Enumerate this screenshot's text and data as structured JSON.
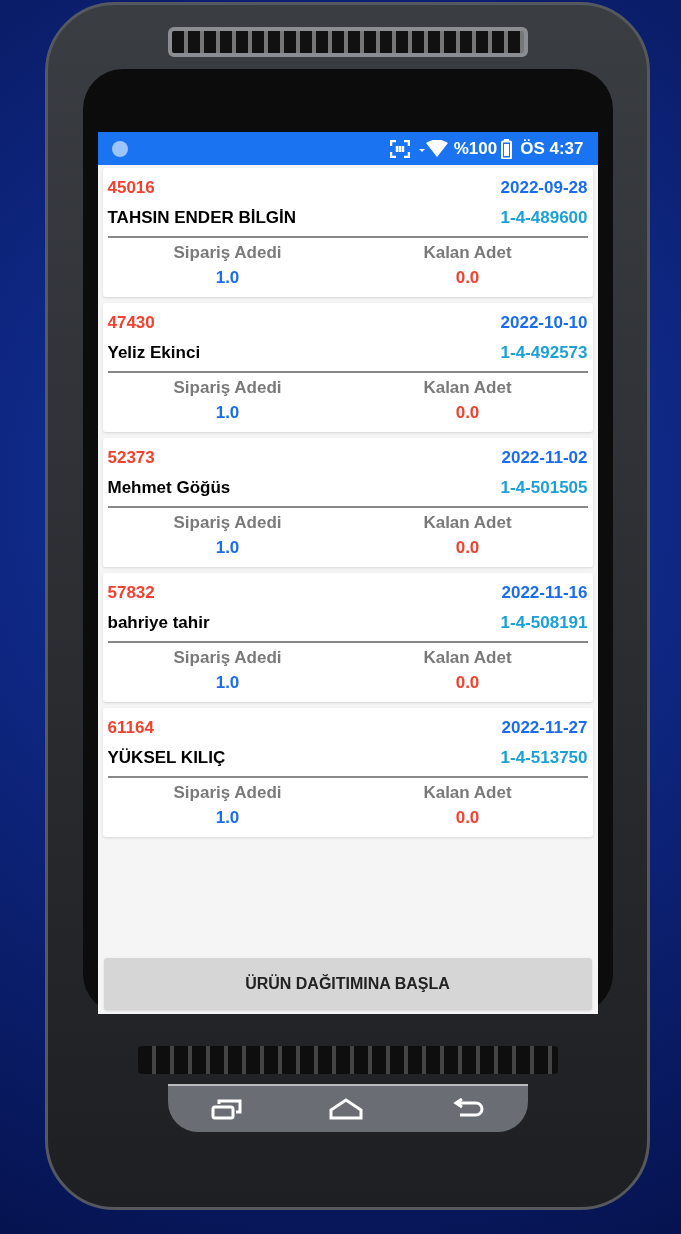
{
  "status_bar": {
    "battery": "%100",
    "time": "ÖS 4:37"
  },
  "orders": [
    {
      "id": "45016",
      "date": "2022-09-28",
      "customer": "TAHSIN ENDER BİLGİN",
      "order_no": "1-4-489600",
      "ordered_label": "Sipariş Adedi",
      "ordered": "1.0",
      "remaining_label": "Kalan Adet",
      "remaining": "0.0"
    },
    {
      "id": "47430",
      "date": "2022-10-10",
      "customer": "Yeliz Ekinci",
      "order_no": "1-4-492573",
      "ordered_label": "Sipariş Adedi",
      "ordered": "1.0",
      "remaining_label": "Kalan Adet",
      "remaining": "0.0"
    },
    {
      "id": "52373",
      "date": "2022-11-02",
      "customer": "Mehmet Göğüs",
      "order_no": "1-4-501505",
      "ordered_label": "Sipariş Adedi",
      "ordered": "1.0",
      "remaining_label": "Kalan Adet",
      "remaining": "0.0"
    },
    {
      "id": "57832",
      "date": "2022-11-16",
      "customer": "bahriye tahir",
      "order_no": "1-4-508191",
      "ordered_label": "Sipariş Adedi",
      "ordered": "1.0",
      "remaining_label": "Kalan Adet",
      "remaining": "0.0"
    },
    {
      "id": "61164",
      "date": "2022-11-27",
      "customer": "YÜKSEL KILIÇ",
      "order_no": "1-4-513750",
      "ordered_label": "Sipariş Adedi",
      "ordered": "1.0",
      "remaining_label": "Kalan Adet",
      "remaining": "0.0"
    }
  ],
  "action_button": "ÜRÜN DAĞITIMINA BAŞLA"
}
